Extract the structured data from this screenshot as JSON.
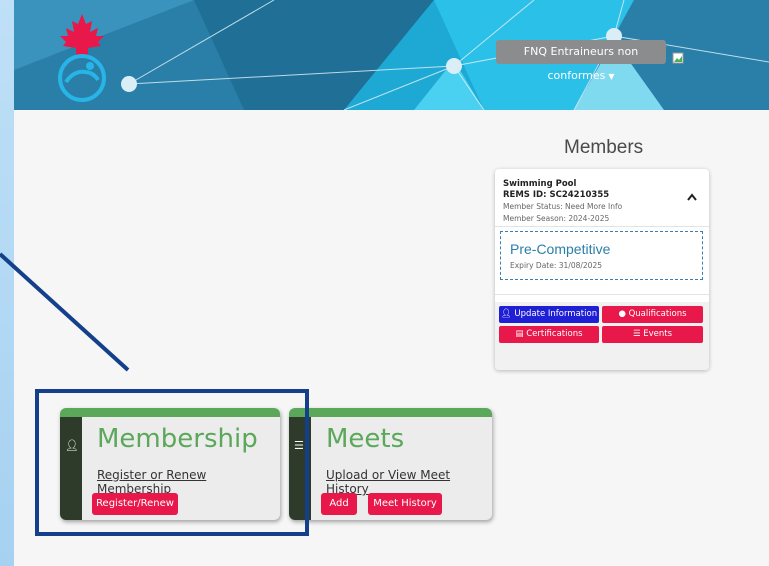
{
  "header": {
    "user_menu_label": "FNQ Entraineurs non conformes",
    "colors": {
      "header_bg": "#2a7fa8",
      "maple_leaf": "#e8194a"
    }
  },
  "members": {
    "title": "Members",
    "card": {
      "pool_name": "Swimming Pool",
      "rems_id": "REMS ID: SC24210355",
      "member_status": "Member Status: Need More Info",
      "member_season": "Member Season: 2024-2025",
      "category": "Pre-Competitive",
      "expiry": "Expiry Date: 31/08/2025",
      "buttons": {
        "update_information": "Update Information",
        "qualifications": "Qualifications",
        "certifications": "Certifications",
        "events": "Events"
      }
    }
  },
  "tiles": {
    "membership": {
      "title": "Membership",
      "link": "Register or Renew Membership",
      "buttons": [
        "Register/Renew"
      ]
    },
    "meets": {
      "title": "Meets",
      "link": "Upload or View Meet History",
      "buttons": [
        "Add",
        "Meet History"
      ]
    }
  },
  "colors": {
    "accent_red": "#e8194a",
    "accent_blue": "#1f1fd6",
    "tile_green": "#5ba85a",
    "highlight_border": "#143f8a"
  }
}
